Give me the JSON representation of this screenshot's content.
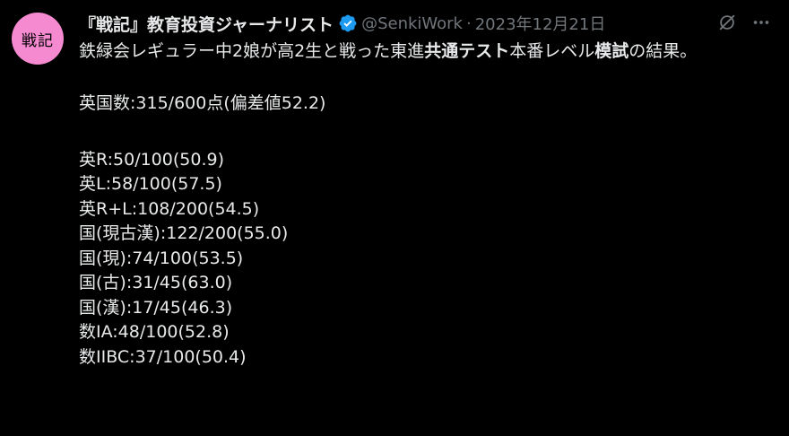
{
  "author": {
    "avatar_text": "戦記",
    "display_name": "『戦記』教育投資ジャーナリスト",
    "verified_icon": "verified-badge-icon",
    "handle": "@SenkiWork",
    "separator": "·",
    "date": "2023年12月21日"
  },
  "actions": {
    "grok_icon": "grok-icon",
    "more_icon": "more-options-icon"
  },
  "colors": {
    "background": "#000000",
    "text": "#e7e9ea",
    "secondary": "#71767b",
    "avatar_bg": "#f58ad1",
    "verified": "#1d9bf0"
  },
  "post": {
    "intro": {
      "p1": "鉄緑会レギュラー中2娘が高2生と戦った東進",
      "b1": "共通テスト",
      "p2": "本番レベル",
      "b2": "模試",
      "p3": "の結果。"
    },
    "total": "英国数:315/600点(偏差値52.2)",
    "scores": [
      "英R:50/100(50.9)",
      "英L:58/100(57.5)",
      "英R+L:108/200(54.5)",
      "国(現古漢):122/200(55.0)",
      "国(現):74/100(53.5)",
      "国(古):31/45(63.0)",
      "国(漢):17/45(46.3)",
      "数IA:48/100(52.8)",
      "数IIBC:37/100(50.4)"
    ]
  }
}
